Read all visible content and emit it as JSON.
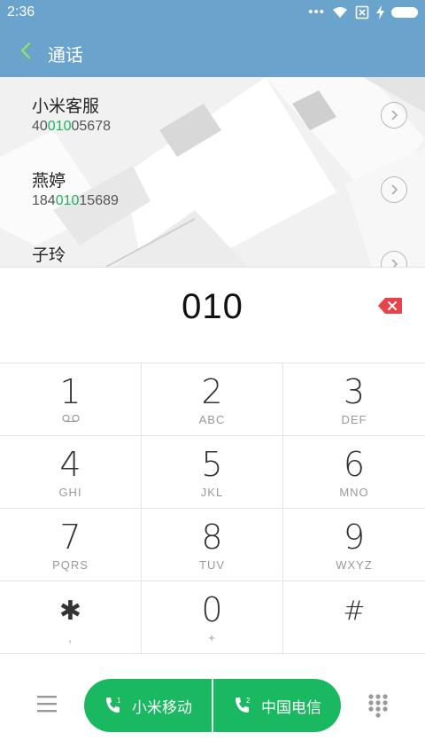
{
  "status_bar": {
    "time": "2:36",
    "dots": "•••"
  },
  "header": {
    "title": "通话"
  },
  "contacts": [
    {
      "name": "小米客服",
      "number_pre": "40",
      "number_match": "010",
      "number_post": "05678"
    },
    {
      "name": "燕婷",
      "number_pre": "184",
      "number_match": "010",
      "number_post": "15689"
    },
    {
      "name": "子玲",
      "number_pre": "",
      "number_match": "",
      "number_post": ""
    }
  ],
  "display": {
    "digits": "010"
  },
  "keypad": {
    "keys": [
      {
        "digit": "1",
        "sub": "",
        "icon": "voicemail-icon"
      },
      {
        "digit": "2",
        "sub": "ABC"
      },
      {
        "digit": "3",
        "sub": "DEF"
      },
      {
        "digit": "4",
        "sub": "GHI"
      },
      {
        "digit": "5",
        "sub": "JKL"
      },
      {
        "digit": "6",
        "sub": "MNO"
      },
      {
        "digit": "7",
        "sub": "PQRS"
      },
      {
        "digit": "8",
        "sub": "TUV"
      },
      {
        "digit": "9",
        "sub": "WXYZ"
      },
      {
        "digit": "✱",
        "sub": ","
      },
      {
        "digit": "0",
        "sub": "+"
      },
      {
        "digit": "#",
        "sub": ""
      }
    ]
  },
  "bottom": {
    "sim1_label": "小米移动",
    "sim1_badge": "1",
    "sim2_label": "中国电信",
    "sim2_badge": "2"
  },
  "colors": {
    "header_bg": "#6aa3cc",
    "call_green": "#1bb862",
    "match_green": "#19b55e",
    "delete_red": "#e8434a",
    "back_arrow": "#8ee06b"
  }
}
